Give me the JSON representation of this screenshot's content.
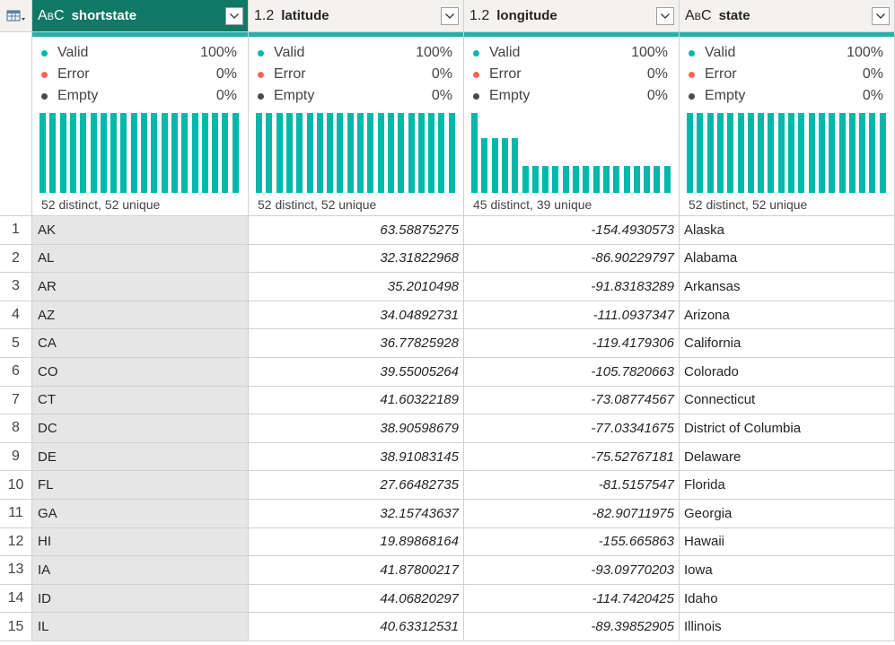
{
  "columns": [
    {
      "type_icon": "ABC",
      "name": "shortstate",
      "selected": true,
      "valid_label": "Valid",
      "valid_pct": "100%",
      "error_label": "Error",
      "error_pct": "0%",
      "empty_label": "Empty",
      "empty_pct": "0%",
      "distinct": "52 distinct, 52 unique",
      "distribution": [
        1,
        1,
        1,
        1,
        1,
        1,
        1,
        1,
        1,
        1,
        1,
        1,
        1,
        1,
        1,
        1,
        1,
        1,
        1,
        1
      ]
    },
    {
      "type_icon": "1.2",
      "name": "latitude",
      "selected": false,
      "valid_label": "Valid",
      "valid_pct": "100%",
      "error_label": "Error",
      "error_pct": "0%",
      "empty_label": "Empty",
      "empty_pct": "0%",
      "distinct": "52 distinct, 52 unique",
      "distribution": [
        1,
        1,
        1,
        1,
        1,
        1,
        1,
        1,
        1,
        1,
        1,
        1,
        1,
        1,
        1,
        1,
        1,
        1,
        1,
        1
      ]
    },
    {
      "type_icon": "1.2",
      "name": "longitude",
      "selected": false,
      "valid_label": "Valid",
      "valid_pct": "100%",
      "error_label": "Error",
      "error_pct": "0%",
      "empty_label": "Empty",
      "empty_pct": "0%",
      "distinct": "45 distinct, 39 unique",
      "distribution": [
        1,
        0.68,
        0.68,
        0.68,
        0.68,
        0.34,
        0.34,
        0.34,
        0.34,
        0.34,
        0.34,
        0.34,
        0.34,
        0.34,
        0.34,
        0.34,
        0.34,
        0.34,
        0.34,
        0.34
      ]
    },
    {
      "type_icon": "ABC",
      "name": "state",
      "selected": false,
      "valid_label": "Valid",
      "valid_pct": "100%",
      "error_label": "Error",
      "error_pct": "0%",
      "empty_label": "Empty",
      "empty_pct": "0%",
      "distinct": "52 distinct, 52 unique",
      "distribution": [
        1,
        1,
        1,
        1,
        1,
        1,
        1,
        1,
        1,
        1,
        1,
        1,
        1,
        1,
        1,
        1,
        1,
        1,
        1,
        1
      ]
    }
  ],
  "colors": {
    "valid": "#01b8aa",
    "error": "#fd625e",
    "empty": "#4a4a4a",
    "selected_header": "#117865"
  },
  "rows": [
    {
      "idx": "1",
      "shortstate": "AK",
      "latitude": "63.58875275",
      "longitude": "-154.4930573",
      "state": "Alaska"
    },
    {
      "idx": "2",
      "shortstate": "AL",
      "latitude": "32.31822968",
      "longitude": "-86.90229797",
      "state": "Alabama"
    },
    {
      "idx": "3",
      "shortstate": "AR",
      "latitude": "35.2010498",
      "longitude": "-91.83183289",
      "state": "Arkansas"
    },
    {
      "idx": "4",
      "shortstate": "AZ",
      "latitude": "34.04892731",
      "longitude": "-111.0937347",
      "state": "Arizona"
    },
    {
      "idx": "5",
      "shortstate": "CA",
      "latitude": "36.77825928",
      "longitude": "-119.4179306",
      "state": "California"
    },
    {
      "idx": "6",
      "shortstate": "CO",
      "latitude": "39.55005264",
      "longitude": "-105.7820663",
      "state": "Colorado"
    },
    {
      "idx": "7",
      "shortstate": "CT",
      "latitude": "41.60322189",
      "longitude": "-73.08774567",
      "state": "Connecticut"
    },
    {
      "idx": "8",
      "shortstate": "DC",
      "latitude": "38.90598679",
      "longitude": "-77.03341675",
      "state": "District of Columbia"
    },
    {
      "idx": "9",
      "shortstate": "DE",
      "latitude": "38.91083145",
      "longitude": "-75.52767181",
      "state": "Delaware"
    },
    {
      "idx": "10",
      "shortstate": "FL",
      "latitude": "27.66482735",
      "longitude": "-81.5157547",
      "state": "Florida"
    },
    {
      "idx": "11",
      "shortstate": "GA",
      "latitude": "32.15743637",
      "longitude": "-82.90711975",
      "state": "Georgia"
    },
    {
      "idx": "12",
      "shortstate": "HI",
      "latitude": "19.89868164",
      "longitude": "-155.665863",
      "state": "Hawaii"
    },
    {
      "idx": "13",
      "shortstate": "IA",
      "latitude": "41.87800217",
      "longitude": "-93.09770203",
      "state": "Iowa"
    },
    {
      "idx": "14",
      "shortstate": "ID",
      "latitude": "44.06820297",
      "longitude": "-114.7420425",
      "state": "Idaho"
    },
    {
      "idx": "15",
      "shortstate": "IL",
      "latitude": "40.63312531",
      "longitude": "-89.39852905",
      "state": "Illinois"
    }
  ]
}
